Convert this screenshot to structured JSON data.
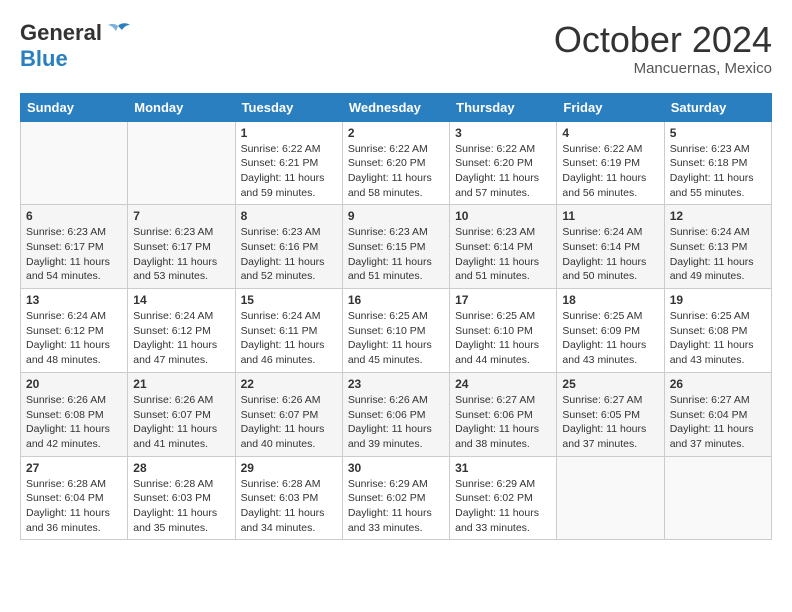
{
  "logo": {
    "general": "General",
    "blue": "Blue"
  },
  "title": "October 2024",
  "location": "Mancuernas, Mexico",
  "days_of_week": [
    "Sunday",
    "Monday",
    "Tuesday",
    "Wednesday",
    "Thursday",
    "Friday",
    "Saturday"
  ],
  "weeks": [
    [
      {
        "num": "",
        "sunrise": "",
        "sunset": "",
        "daylight": ""
      },
      {
        "num": "",
        "sunrise": "",
        "sunset": "",
        "daylight": ""
      },
      {
        "num": "1",
        "sunrise": "Sunrise: 6:22 AM",
        "sunset": "Sunset: 6:21 PM",
        "daylight": "Daylight: 11 hours and 59 minutes."
      },
      {
        "num": "2",
        "sunrise": "Sunrise: 6:22 AM",
        "sunset": "Sunset: 6:20 PM",
        "daylight": "Daylight: 11 hours and 58 minutes."
      },
      {
        "num": "3",
        "sunrise": "Sunrise: 6:22 AM",
        "sunset": "Sunset: 6:20 PM",
        "daylight": "Daylight: 11 hours and 57 minutes."
      },
      {
        "num": "4",
        "sunrise": "Sunrise: 6:22 AM",
        "sunset": "Sunset: 6:19 PM",
        "daylight": "Daylight: 11 hours and 56 minutes."
      },
      {
        "num": "5",
        "sunrise": "Sunrise: 6:23 AM",
        "sunset": "Sunset: 6:18 PM",
        "daylight": "Daylight: 11 hours and 55 minutes."
      }
    ],
    [
      {
        "num": "6",
        "sunrise": "Sunrise: 6:23 AM",
        "sunset": "Sunset: 6:17 PM",
        "daylight": "Daylight: 11 hours and 54 minutes."
      },
      {
        "num": "7",
        "sunrise": "Sunrise: 6:23 AM",
        "sunset": "Sunset: 6:17 PM",
        "daylight": "Daylight: 11 hours and 53 minutes."
      },
      {
        "num": "8",
        "sunrise": "Sunrise: 6:23 AM",
        "sunset": "Sunset: 6:16 PM",
        "daylight": "Daylight: 11 hours and 52 minutes."
      },
      {
        "num": "9",
        "sunrise": "Sunrise: 6:23 AM",
        "sunset": "Sunset: 6:15 PM",
        "daylight": "Daylight: 11 hours and 51 minutes."
      },
      {
        "num": "10",
        "sunrise": "Sunrise: 6:23 AM",
        "sunset": "Sunset: 6:14 PM",
        "daylight": "Daylight: 11 hours and 51 minutes."
      },
      {
        "num": "11",
        "sunrise": "Sunrise: 6:24 AM",
        "sunset": "Sunset: 6:14 PM",
        "daylight": "Daylight: 11 hours and 50 minutes."
      },
      {
        "num": "12",
        "sunrise": "Sunrise: 6:24 AM",
        "sunset": "Sunset: 6:13 PM",
        "daylight": "Daylight: 11 hours and 49 minutes."
      }
    ],
    [
      {
        "num": "13",
        "sunrise": "Sunrise: 6:24 AM",
        "sunset": "Sunset: 6:12 PM",
        "daylight": "Daylight: 11 hours and 48 minutes."
      },
      {
        "num": "14",
        "sunrise": "Sunrise: 6:24 AM",
        "sunset": "Sunset: 6:12 PM",
        "daylight": "Daylight: 11 hours and 47 minutes."
      },
      {
        "num": "15",
        "sunrise": "Sunrise: 6:24 AM",
        "sunset": "Sunset: 6:11 PM",
        "daylight": "Daylight: 11 hours and 46 minutes."
      },
      {
        "num": "16",
        "sunrise": "Sunrise: 6:25 AM",
        "sunset": "Sunset: 6:10 PM",
        "daylight": "Daylight: 11 hours and 45 minutes."
      },
      {
        "num": "17",
        "sunrise": "Sunrise: 6:25 AM",
        "sunset": "Sunset: 6:10 PM",
        "daylight": "Daylight: 11 hours and 44 minutes."
      },
      {
        "num": "18",
        "sunrise": "Sunrise: 6:25 AM",
        "sunset": "Sunset: 6:09 PM",
        "daylight": "Daylight: 11 hours and 43 minutes."
      },
      {
        "num": "19",
        "sunrise": "Sunrise: 6:25 AM",
        "sunset": "Sunset: 6:08 PM",
        "daylight": "Daylight: 11 hours and 43 minutes."
      }
    ],
    [
      {
        "num": "20",
        "sunrise": "Sunrise: 6:26 AM",
        "sunset": "Sunset: 6:08 PM",
        "daylight": "Daylight: 11 hours and 42 minutes."
      },
      {
        "num": "21",
        "sunrise": "Sunrise: 6:26 AM",
        "sunset": "Sunset: 6:07 PM",
        "daylight": "Daylight: 11 hours and 41 minutes."
      },
      {
        "num": "22",
        "sunrise": "Sunrise: 6:26 AM",
        "sunset": "Sunset: 6:07 PM",
        "daylight": "Daylight: 11 hours and 40 minutes."
      },
      {
        "num": "23",
        "sunrise": "Sunrise: 6:26 AM",
        "sunset": "Sunset: 6:06 PM",
        "daylight": "Daylight: 11 hours and 39 minutes."
      },
      {
        "num": "24",
        "sunrise": "Sunrise: 6:27 AM",
        "sunset": "Sunset: 6:06 PM",
        "daylight": "Daylight: 11 hours and 38 minutes."
      },
      {
        "num": "25",
        "sunrise": "Sunrise: 6:27 AM",
        "sunset": "Sunset: 6:05 PM",
        "daylight": "Daylight: 11 hours and 37 minutes."
      },
      {
        "num": "26",
        "sunrise": "Sunrise: 6:27 AM",
        "sunset": "Sunset: 6:04 PM",
        "daylight": "Daylight: 11 hours and 37 minutes."
      }
    ],
    [
      {
        "num": "27",
        "sunrise": "Sunrise: 6:28 AM",
        "sunset": "Sunset: 6:04 PM",
        "daylight": "Daylight: 11 hours and 36 minutes."
      },
      {
        "num": "28",
        "sunrise": "Sunrise: 6:28 AM",
        "sunset": "Sunset: 6:03 PM",
        "daylight": "Daylight: 11 hours and 35 minutes."
      },
      {
        "num": "29",
        "sunrise": "Sunrise: 6:28 AM",
        "sunset": "Sunset: 6:03 PM",
        "daylight": "Daylight: 11 hours and 34 minutes."
      },
      {
        "num": "30",
        "sunrise": "Sunrise: 6:29 AM",
        "sunset": "Sunset: 6:02 PM",
        "daylight": "Daylight: 11 hours and 33 minutes."
      },
      {
        "num": "31",
        "sunrise": "Sunrise: 6:29 AM",
        "sunset": "Sunset: 6:02 PM",
        "daylight": "Daylight: 11 hours and 33 minutes."
      },
      {
        "num": "",
        "sunrise": "",
        "sunset": "",
        "daylight": ""
      },
      {
        "num": "",
        "sunrise": "",
        "sunset": "",
        "daylight": ""
      }
    ]
  ]
}
